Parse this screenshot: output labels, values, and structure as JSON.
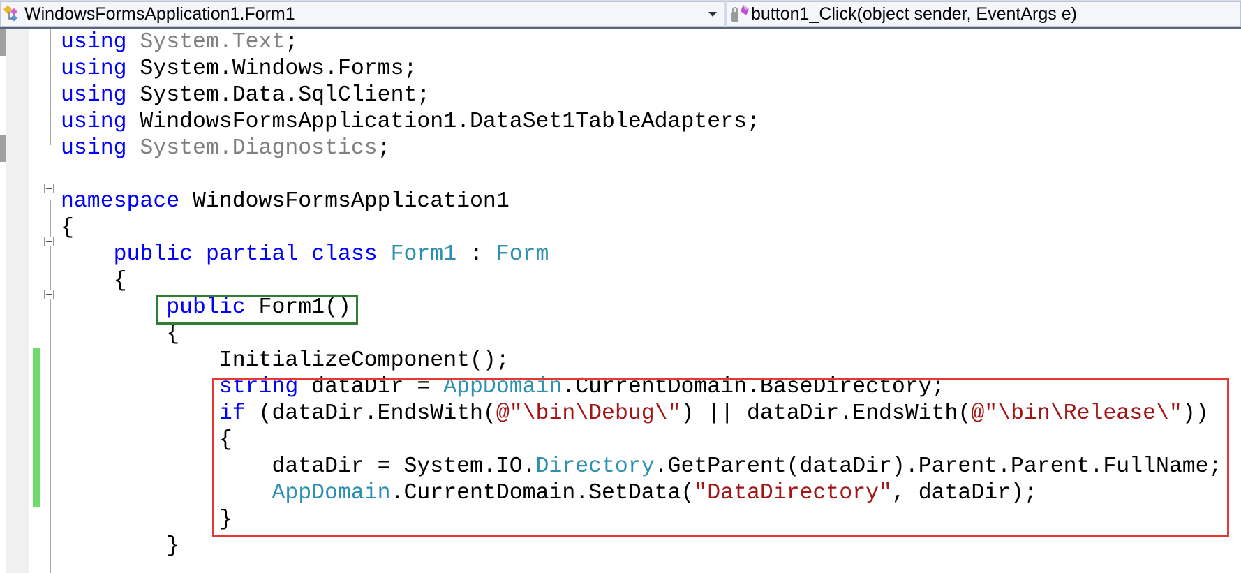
{
  "navbar": {
    "type_combo": {
      "label": "WindowsFormsApplication1.Form1",
      "icon": "class-icon"
    },
    "member_combo": {
      "label": "button1_Click(object sender, EventArgs e)",
      "icon": "method-icon"
    }
  },
  "colors": {
    "keyword": "#0000ff",
    "type": "#2b91af",
    "string": "#a31515",
    "unused": "#808080",
    "change_bar": "#6ddc6d",
    "highlight_green": "#2e7d32",
    "highlight_red": "#e53935"
  },
  "code": {
    "lines": [
      [
        {
          "t": "using",
          "c": "kw"
        },
        {
          "t": " ",
          "c": "pl"
        },
        {
          "t": "System.Text",
          "c": "gr"
        },
        {
          "t": ";",
          "c": "pl"
        }
      ],
      [
        {
          "t": "using",
          "c": "kw"
        },
        {
          "t": " System.Windows.Forms;",
          "c": "pl"
        }
      ],
      [
        {
          "t": "using",
          "c": "kw"
        },
        {
          "t": " System.Data.SqlClient;",
          "c": "pl"
        }
      ],
      [
        {
          "t": "using",
          "c": "kw"
        },
        {
          "t": " WindowsFormsApplication1.DataSet1TableAdapters;",
          "c": "pl"
        }
      ],
      [
        {
          "t": "using",
          "c": "kw"
        },
        {
          "t": " ",
          "c": "pl"
        },
        {
          "t": "System.Diagnostics",
          "c": "gr"
        },
        {
          "t": ";",
          "c": "pl"
        }
      ],
      [],
      [
        {
          "t": "namespace",
          "c": "kw"
        },
        {
          "t": " WindowsFormsApplication1",
          "c": "pl"
        }
      ],
      [
        {
          "t": "{",
          "c": "pl"
        }
      ],
      [
        {
          "t": "    ",
          "c": "pl"
        },
        {
          "t": "public",
          "c": "kw"
        },
        {
          "t": " ",
          "c": "pl"
        },
        {
          "t": "partial",
          "c": "kw"
        },
        {
          "t": " ",
          "c": "pl"
        },
        {
          "t": "class",
          "c": "kw"
        },
        {
          "t": " ",
          "c": "pl"
        },
        {
          "t": "Form1",
          "c": "ty"
        },
        {
          "t": " : ",
          "c": "pl"
        },
        {
          "t": "Form",
          "c": "ty"
        }
      ],
      [
        {
          "t": "    {",
          "c": "pl"
        }
      ],
      [
        {
          "t": "        ",
          "c": "pl"
        },
        {
          "t": "public",
          "c": "kw"
        },
        {
          "t": " Form1()",
          "c": "pl"
        }
      ],
      [
        {
          "t": "        {",
          "c": "pl"
        }
      ],
      [
        {
          "t": "            InitializeComponent();",
          "c": "pl"
        }
      ],
      [
        {
          "t": "            ",
          "c": "pl"
        },
        {
          "t": "string",
          "c": "kw"
        },
        {
          "t": " dataDir = ",
          "c": "pl"
        },
        {
          "t": "AppDomain",
          "c": "ty"
        },
        {
          "t": ".CurrentDomain.BaseDirectory;",
          "c": "pl"
        }
      ],
      [
        {
          "t": "            ",
          "c": "pl"
        },
        {
          "t": "if",
          "c": "kw"
        },
        {
          "t": " (dataDir.EndsWith(",
          "c": "pl"
        },
        {
          "t": "@\"\\bin\\Debug\\\"",
          "c": "st"
        },
        {
          "t": ") || dataDir.EndsWith(",
          "c": "pl"
        },
        {
          "t": "@\"\\bin\\Release\\\"",
          "c": "st"
        },
        {
          "t": "))",
          "c": "pl"
        }
      ],
      [
        {
          "t": "            {",
          "c": "pl"
        }
      ],
      [
        {
          "t": "                dataDir = System.IO.",
          "c": "pl"
        },
        {
          "t": "Directory",
          "c": "ty"
        },
        {
          "t": ".GetParent(dataDir).Parent.Parent.FullName;",
          "c": "pl"
        }
      ],
      [
        {
          "t": "                ",
          "c": "pl"
        },
        {
          "t": "AppDomain",
          "c": "ty"
        },
        {
          "t": ".CurrentDomain.SetData(",
          "c": "pl"
        },
        {
          "t": "\"DataDirectory\"",
          "c": "st"
        },
        {
          "t": ", dataDir);",
          "c": "pl"
        }
      ],
      [
        {
          "t": "            }",
          "c": "pl"
        }
      ],
      [
        {
          "t": "        }",
          "c": "pl"
        }
      ]
    ]
  }
}
